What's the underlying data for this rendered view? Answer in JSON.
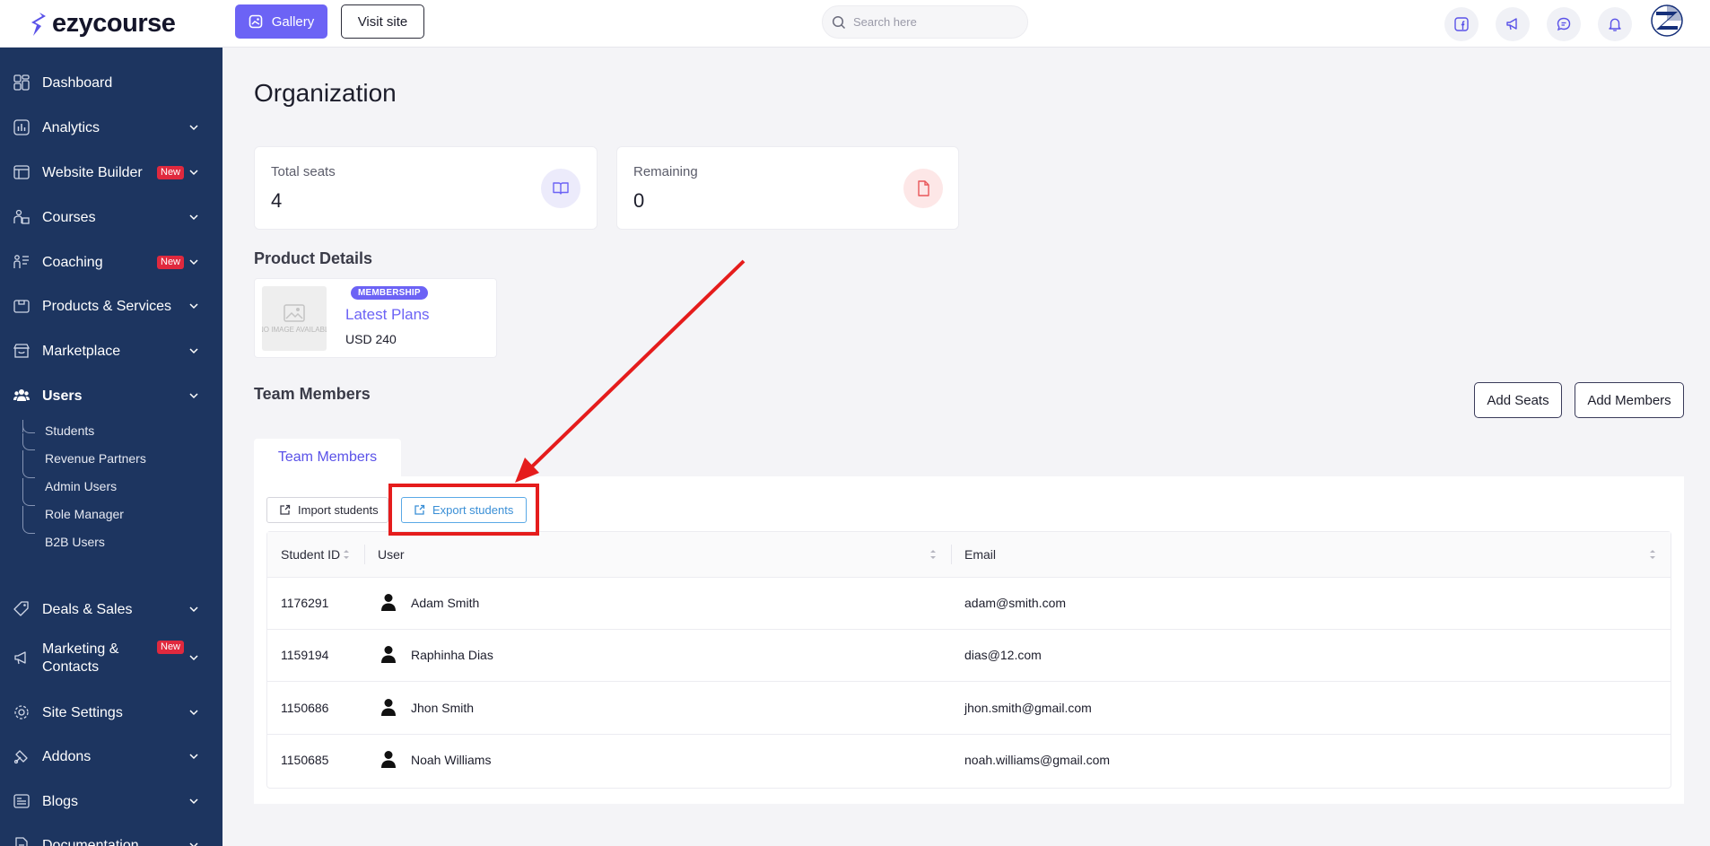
{
  "app": {
    "brand": "ezycourse",
    "accent": "#6c63f5",
    "sidebar_bg": "#1d3560",
    "highlight": "#e51c1c"
  },
  "topbar": {
    "gallery_label": "Gallery",
    "visit_site_label": "Visit site",
    "search_placeholder": "Search here",
    "icons": [
      "facebook-icon",
      "megaphone-icon",
      "chat-icon",
      "bell-icon",
      "profile-avatar"
    ]
  },
  "sidebar": {
    "items": [
      {
        "label": "Dashboard",
        "icon": "dashboard-icon"
      },
      {
        "label": "Analytics",
        "icon": "analytics-icon"
      },
      {
        "label": "Website Builder",
        "icon": "website-icon",
        "badge": "New"
      },
      {
        "label": "Courses",
        "icon": "courses-icon"
      },
      {
        "label": "Coaching",
        "icon": "coaching-icon",
        "badge": "New"
      },
      {
        "label": "Products & Services",
        "icon": "products-icon"
      },
      {
        "label": "Marketplace",
        "icon": "marketplace-icon"
      },
      {
        "label": "Users",
        "icon": "users-icon",
        "active": true
      },
      {
        "label": "Deals & Sales",
        "icon": "deals-icon"
      },
      {
        "label": "Marketing &",
        "label2": "Contacts",
        "icon": "marketing-icon",
        "badge": "New"
      },
      {
        "label": "Site Settings",
        "icon": "settings-icon"
      },
      {
        "label": "Addons",
        "icon": "addons-icon"
      },
      {
        "label": "Blogs",
        "icon": "blogs-icon"
      },
      {
        "label": "Documentation",
        "icon": "documentation-icon"
      }
    ],
    "users_sub": [
      "Students",
      "Revenue Partners",
      "Admin Users",
      "Role Manager",
      "B2B Users"
    ]
  },
  "main": {
    "title": "Organization",
    "stats": [
      {
        "label": "Total seats",
        "value": "4",
        "icon": "book-icon"
      },
      {
        "label": "Remaining",
        "value": "0",
        "icon": "file-icon"
      }
    ],
    "product_details_title": "Product Details",
    "product": {
      "badge": "MEMBERSHIP",
      "name": "Latest Plans",
      "price": "USD 240",
      "placeholder_text": "NO IMAGE AVAILABLE"
    },
    "team_members_title": "Team Members",
    "add_seats_label": "Add Seats",
    "add_members_label": "Add Members",
    "tab_label": "Team Members",
    "import_label": "Import students",
    "export_label": "Export students",
    "table": {
      "headers": [
        "Student ID",
        "User",
        "Email"
      ],
      "rows": [
        {
          "id": "1176291",
          "user": "Adam Smith",
          "email": "adam@smith.com"
        },
        {
          "id": "1159194",
          "user": "Raphinha Dias",
          "email": "dias@12.com"
        },
        {
          "id": "1150686",
          "user": "Jhon Smith",
          "email": "jhon.smith@gmail.com"
        },
        {
          "id": "1150685",
          "user": "Noah Williams",
          "email": "noah.williams@gmail.com"
        }
      ]
    }
  }
}
